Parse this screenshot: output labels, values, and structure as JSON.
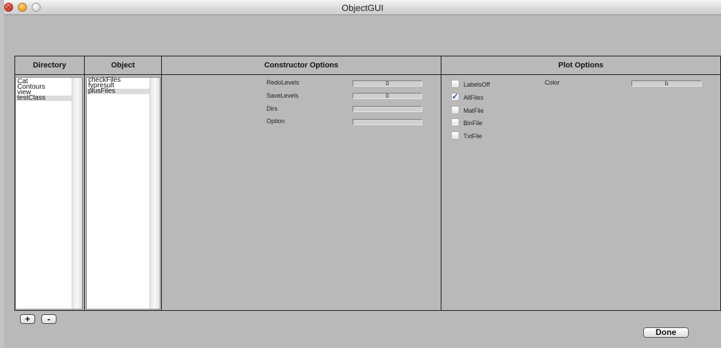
{
  "window": {
    "title": "ObjectGUI"
  },
  "headers": {
    "directory": "Directory",
    "object": "Object",
    "constructor": "Constructor Options",
    "plot": "Plot Options"
  },
  "directory_list": {
    "items": [
      "Cat",
      "Contours",
      "view",
      "testClass"
    ],
    "selected": "testClass"
  },
  "object_list": {
    "items": [
      "checkFiles",
      "fypresult",
      "plusFiles"
    ],
    "selected": "plusFiles"
  },
  "constructor_options": {
    "redo_label": "RedoLevels",
    "redo_value": "0",
    "save_label": "SaveLevels",
    "save_value": "0",
    "dirs_label": "Dirs",
    "dirs_value": "",
    "option_label": "Option",
    "option_value": ""
  },
  "plot_options": {
    "labelsoff_label": "LabelsOff",
    "labelsoff_checked": false,
    "allfiles_label": "AllFiles",
    "allfiles_checked": true,
    "matfile_label": "MatFile",
    "matfile_checked": false,
    "binfile_label": "BinFile",
    "binfile_checked": false,
    "txtfile_label": "TxtFile",
    "txtfile_checked": false,
    "color_label": "Color",
    "color_value": "b"
  },
  "buttons": {
    "add": "+",
    "remove": "-",
    "done": "Done"
  },
  "icons": {
    "check": "checkmark-icon"
  }
}
